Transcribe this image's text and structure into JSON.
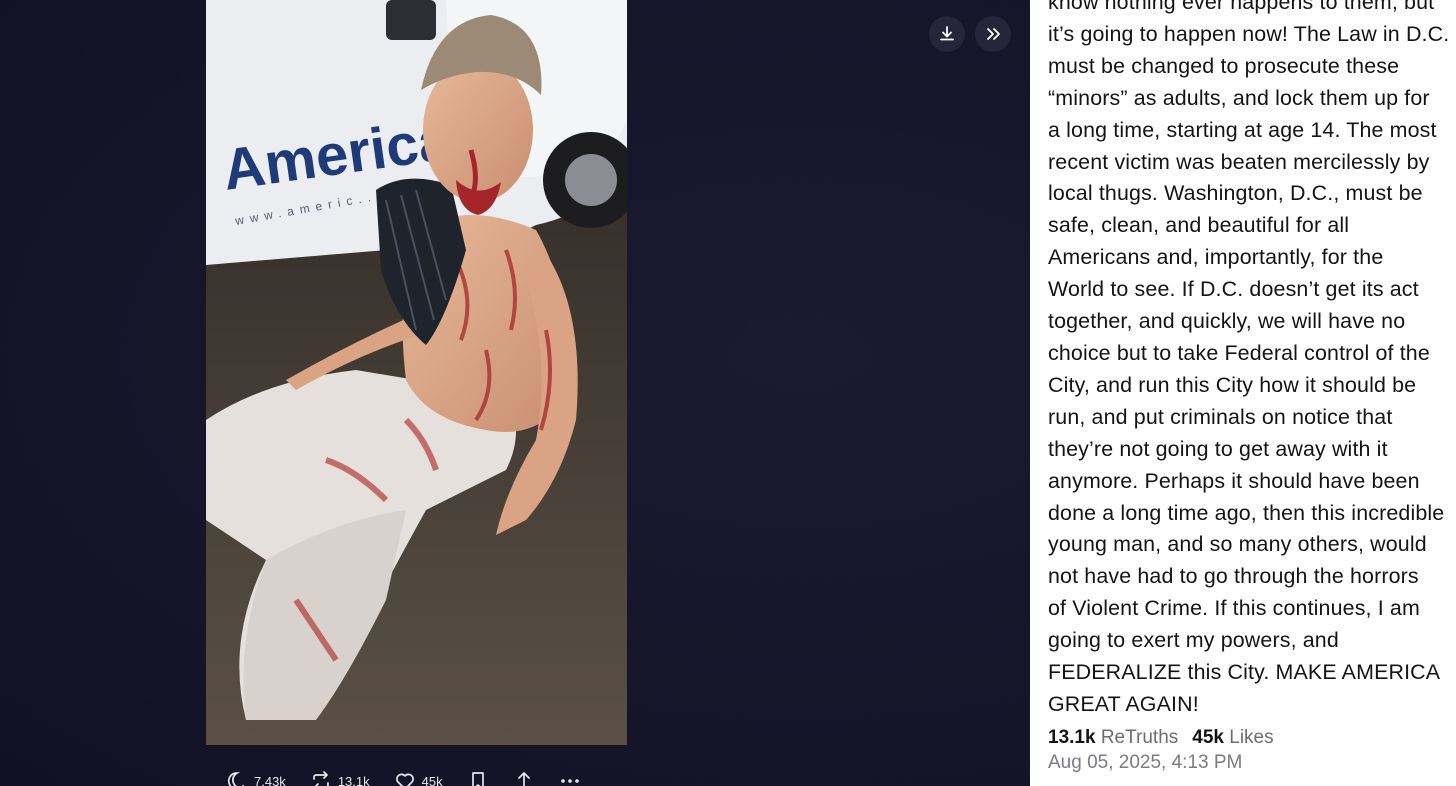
{
  "media": {
    "download_icon": "download-icon",
    "expand_icon": "chevrons-right-icon",
    "photo_text": "American",
    "photo_url_text": "www.americ..."
  },
  "actions": {
    "replies": "7.43k",
    "retruths": "13.1k",
    "likes": "45k"
  },
  "post": {
    "text": "know nothing ever happens to them, but\nit’s going to happen now! The Law in D.C.\nmust be changed to prosecute these\n“minors” as adults, and lock them up for\na long time, starting at age 14. The most\nrecent victim was beaten mercilessly by\nlocal thugs. Washington, D.C., must be\nsafe, clean, and beautiful for all\nAmericans and, importantly, for the\nWorld to see. If D.C. doesn’t get its act\ntogether, and quickly, we will have no\nchoice but to take Federal control of the\nCity, and run this City how it should be\nrun, and put criminals on notice that\nthey’re not going to get away with it\nanymore. Perhaps it should have been\ndone a long time ago, then this incredible\nyoung man, and so many others, would\nnot have had to go through the horrors\nof Violent Crime. If this continues, I am\ngoing to exert my powers, and\nFEDERALIZE this City. MAKE AMERICA\nGREAT AGAIN!",
    "retruths_count": "13.1k",
    "retruths_label": "ReTruths",
    "likes_count": "45k",
    "likes_label": "Likes",
    "timestamp": "Aug 05, 2025, 4:13 PM"
  },
  "colors": {
    "viewer_bg": "#16152a",
    "panel_bg": "#ffffff",
    "text": "#141414",
    "muted": "#7b7b86"
  }
}
